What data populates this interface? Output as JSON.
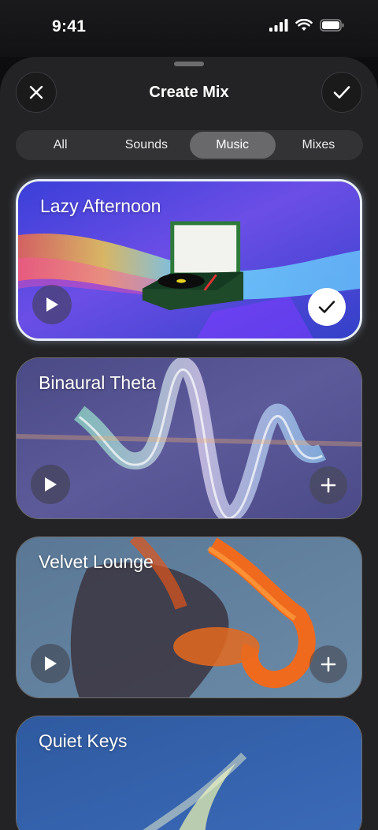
{
  "status": {
    "time": "9:41"
  },
  "header": {
    "title": "Create Mix"
  },
  "tabs": [
    {
      "label": "All",
      "active": false
    },
    {
      "label": "Sounds",
      "active": false
    },
    {
      "label": "Music",
      "active": true
    },
    {
      "label": "Mixes",
      "active": false
    }
  ],
  "cards": [
    {
      "title": "Lazy Afternoon",
      "selected": true
    },
    {
      "title": "Binaural Theta",
      "selected": false
    },
    {
      "title": "Velvet Lounge",
      "selected": false
    },
    {
      "title": "Quiet Keys",
      "selected": false
    }
  ],
  "icons": {
    "close": "close-icon",
    "confirm": "checkmark-icon",
    "play": "play-icon",
    "add": "plus-icon",
    "selected": "checkmark-icon"
  }
}
